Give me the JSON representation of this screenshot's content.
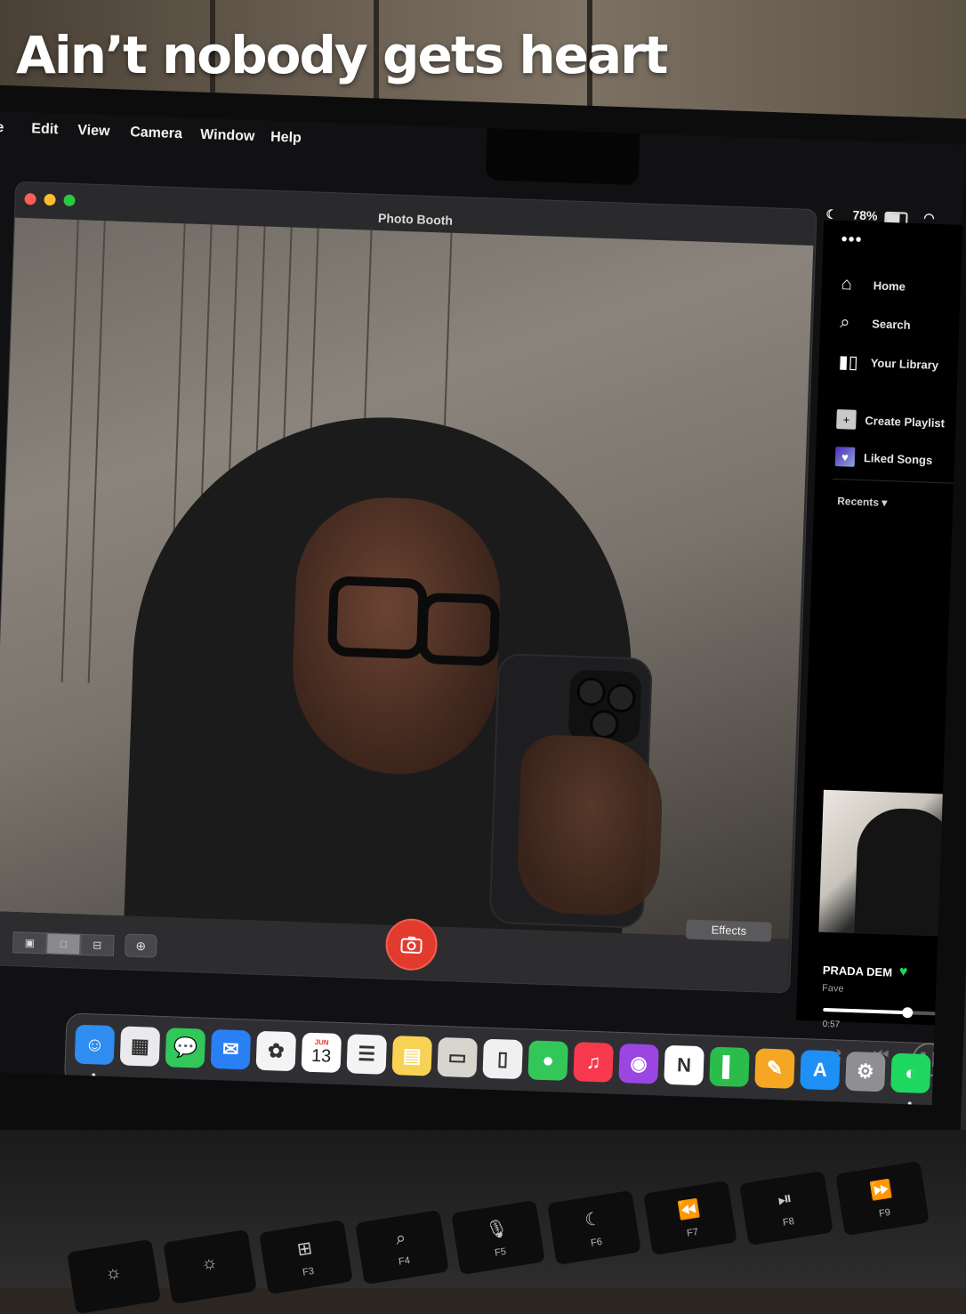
{
  "caption": "Ain’t nobody gets heart",
  "menubar": {
    "items": [
      "e",
      "Edit",
      "View",
      "Camera",
      "Window",
      "Help"
    ]
  },
  "status": {
    "battery": "78%",
    "icons": [
      "moon-icon",
      "battery-icon",
      "wifi-icon"
    ]
  },
  "photo_booth": {
    "title": "Photo Booth",
    "effects_label": "Effects",
    "modes": [
      "burst-mode",
      "single-photo-mode",
      "video-mode"
    ],
    "active_mode": "single-photo-mode"
  },
  "spotify": {
    "menu_dots": "•••",
    "nav": [
      "Home",
      "Search",
      "Your Library"
    ],
    "actions": [
      "Create Playlist",
      "Liked Songs"
    ],
    "recents_label": "Recents",
    "now_playing": {
      "title": "PRADA DEM",
      "artist": "Fave",
      "elapsed": "0:57",
      "progress": 0.68,
      "liked": true
    },
    "colors": {
      "accent": "#1ed760",
      "liked_songs_gradient": "#4b2bbd"
    }
  },
  "dock": {
    "apps": [
      {
        "name": "finder",
        "glyph": "☺",
        "color": "#2f8cf0",
        "running": true
      },
      {
        "name": "launchpad",
        "glyph": "▦",
        "color": "#e9e9ee",
        "running": false
      },
      {
        "name": "messages",
        "glyph": "💬",
        "color": "#32c759",
        "running": false
      },
      {
        "name": "mail",
        "glyph": "✉",
        "color": "#2a7ff5",
        "running": false
      },
      {
        "name": "photos",
        "glyph": "✿",
        "color": "#f4f4f4",
        "running": false
      },
      {
        "name": "calendar",
        "month": "JUN",
        "day": "13",
        "color": "#ffffff",
        "running": false
      },
      {
        "name": "reminders",
        "glyph": "☰",
        "color": "#f4f4f4",
        "running": false
      },
      {
        "name": "notes",
        "glyph": "▤",
        "color": "#f7d255",
        "running": false
      },
      {
        "name": "freeform",
        "glyph": "▭",
        "color": "#d8d5cf",
        "running": false
      },
      {
        "name": "testflight",
        "glyph": "▯",
        "color": "#f0f0f0",
        "running": false
      },
      {
        "name": "facetime",
        "glyph": "●",
        "color": "#33c75a",
        "running": false
      },
      {
        "name": "music",
        "glyph": "♫",
        "color": "#f8384d",
        "running": false
      },
      {
        "name": "podcasts",
        "glyph": "◉",
        "color": "#9b45e2",
        "running": false
      },
      {
        "name": "notion",
        "glyph": "N",
        "color": "#ffffff",
        "running": false
      },
      {
        "name": "numbers",
        "glyph": "▌",
        "color": "#2bbd4c",
        "running": false
      },
      {
        "name": "pages",
        "glyph": "✎",
        "color": "#f5a623",
        "running": false
      },
      {
        "name": "app-store",
        "glyph": "A",
        "color": "#1e8ff5",
        "running": false
      },
      {
        "name": "system-settings",
        "glyph": "⚙",
        "color": "#8e8e93",
        "running": false
      },
      {
        "name": "spotify",
        "glyph": "◐",
        "color": "#1ed760",
        "running": true
      }
    ]
  },
  "keyboard": {
    "keys": [
      {
        "fn": "",
        "glyph": "☼"
      },
      {
        "fn": "",
        "glyph": "☼"
      },
      {
        "fn": "F3",
        "glyph": "⊞"
      },
      {
        "fn": "F4",
        "glyph": "⌕"
      },
      {
        "fn": "F5",
        "glyph": "🎙"
      },
      {
        "fn": "F6",
        "glyph": "☾"
      },
      {
        "fn": "F7",
        "glyph": "⏪"
      },
      {
        "fn": "F8",
        "glyph": "⏯"
      },
      {
        "fn": "F9",
        "glyph": "⏩"
      }
    ]
  }
}
